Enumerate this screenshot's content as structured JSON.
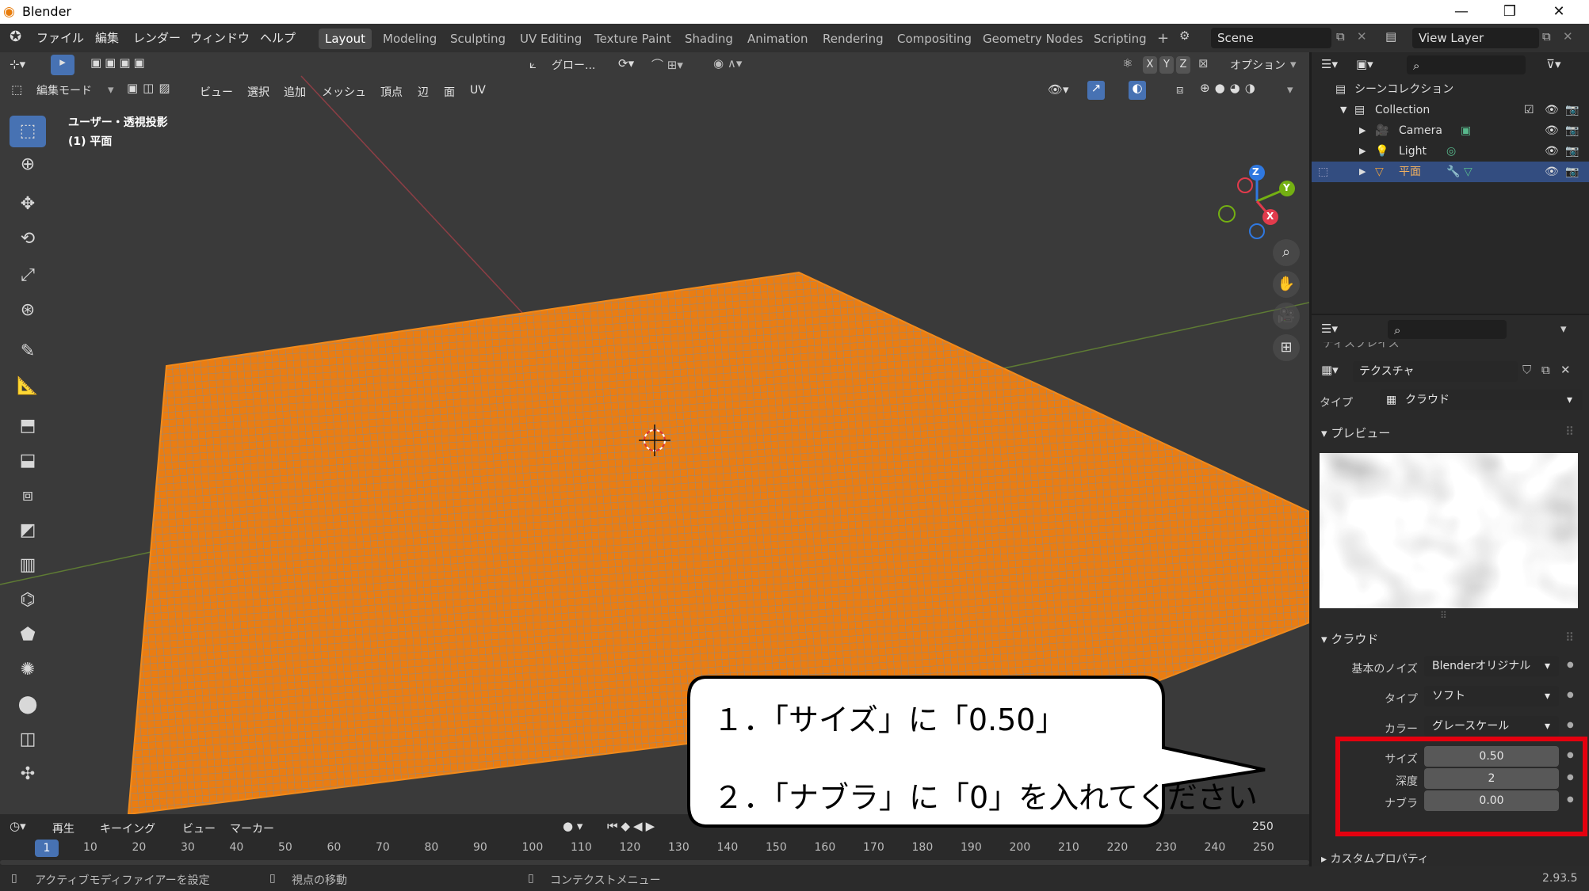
{
  "window": {
    "title": "Blender",
    "min": "—",
    "max": "❒",
    "close": "✕"
  },
  "menu": [
    "ファイル",
    "編集",
    "レンダー",
    "ウィンドウ",
    "ヘルプ"
  ],
  "workspaces": [
    "Layout",
    "Modeling",
    "Sculpting",
    "UV Editing",
    "Texture Paint",
    "Shading",
    "Animation",
    "Rendering",
    "Compositing",
    "Geometry Nodes",
    "Scripting"
  ],
  "add_tab": "+",
  "scene": "Scene",
  "view_layer": "View Layer",
  "viewport": {
    "mode": "編集モード",
    "menus": [
      "ビュー",
      "選択",
      "追加",
      "メッシュ",
      "頂点",
      "辺",
      "面",
      "UV"
    ],
    "transform": "グロー...",
    "options": "オプション",
    "axes": [
      "X",
      "Y",
      "Z"
    ],
    "overlay_line1": "ユーザー・透視投影",
    "overlay_line2": "(1) 平面",
    "gizmo": {
      "z": "Z",
      "y": "Y",
      "x": "X"
    },
    "mesh_color": "#e87d0d"
  },
  "outliner": {
    "root": "シーンコレクション",
    "collection": "Collection",
    "items": [
      "Camera",
      "Light",
      "平面"
    ]
  },
  "properties": {
    "top_section": "ディスプレイス",
    "texture_name": "テクスチャ",
    "type_label": "タイプ",
    "type_value": "クラウド",
    "preview_label": "プレビュー",
    "clouds_label": "クラウド",
    "noise_label": "基本のノイズ",
    "noise_value": "Blenderオリジナル",
    "ctype_label": "タイプ",
    "ctype_value": "ソフト",
    "color_label": "カラー",
    "color_value": "グレースケール",
    "size_label": "サイズ",
    "size_value": "0.50",
    "depth_label": "深度",
    "depth_value": "2",
    "nabla_label": "ナブラ",
    "nabla_value": "0.00",
    "custom_props": "カスタムプロパティ"
  },
  "timeline": {
    "menus": [
      "再生",
      "キーイング",
      "ビュー",
      "マーカー"
    ],
    "current": "1",
    "end": "250",
    "ticks": [
      "10",
      "20",
      "30",
      "40",
      "50",
      "60",
      "70",
      "80",
      "90",
      "100",
      "110",
      "120",
      "130",
      "140",
      "150",
      "160",
      "170",
      "180",
      "190",
      "200",
      "210",
      "220",
      "230",
      "240",
      "250"
    ]
  },
  "status": {
    "left": "アクティブモディファイアーを設定",
    "mid": "視点の移動",
    "right": "コンテクストメニュー",
    "version": "2.93.5"
  },
  "callout": {
    "line1": "１．「サイズ」に「0.50」",
    "line2": "２．「ナブラ」に「0」を入れてください"
  },
  "accent": "#4772b3",
  "highlight": "#e5000f"
}
